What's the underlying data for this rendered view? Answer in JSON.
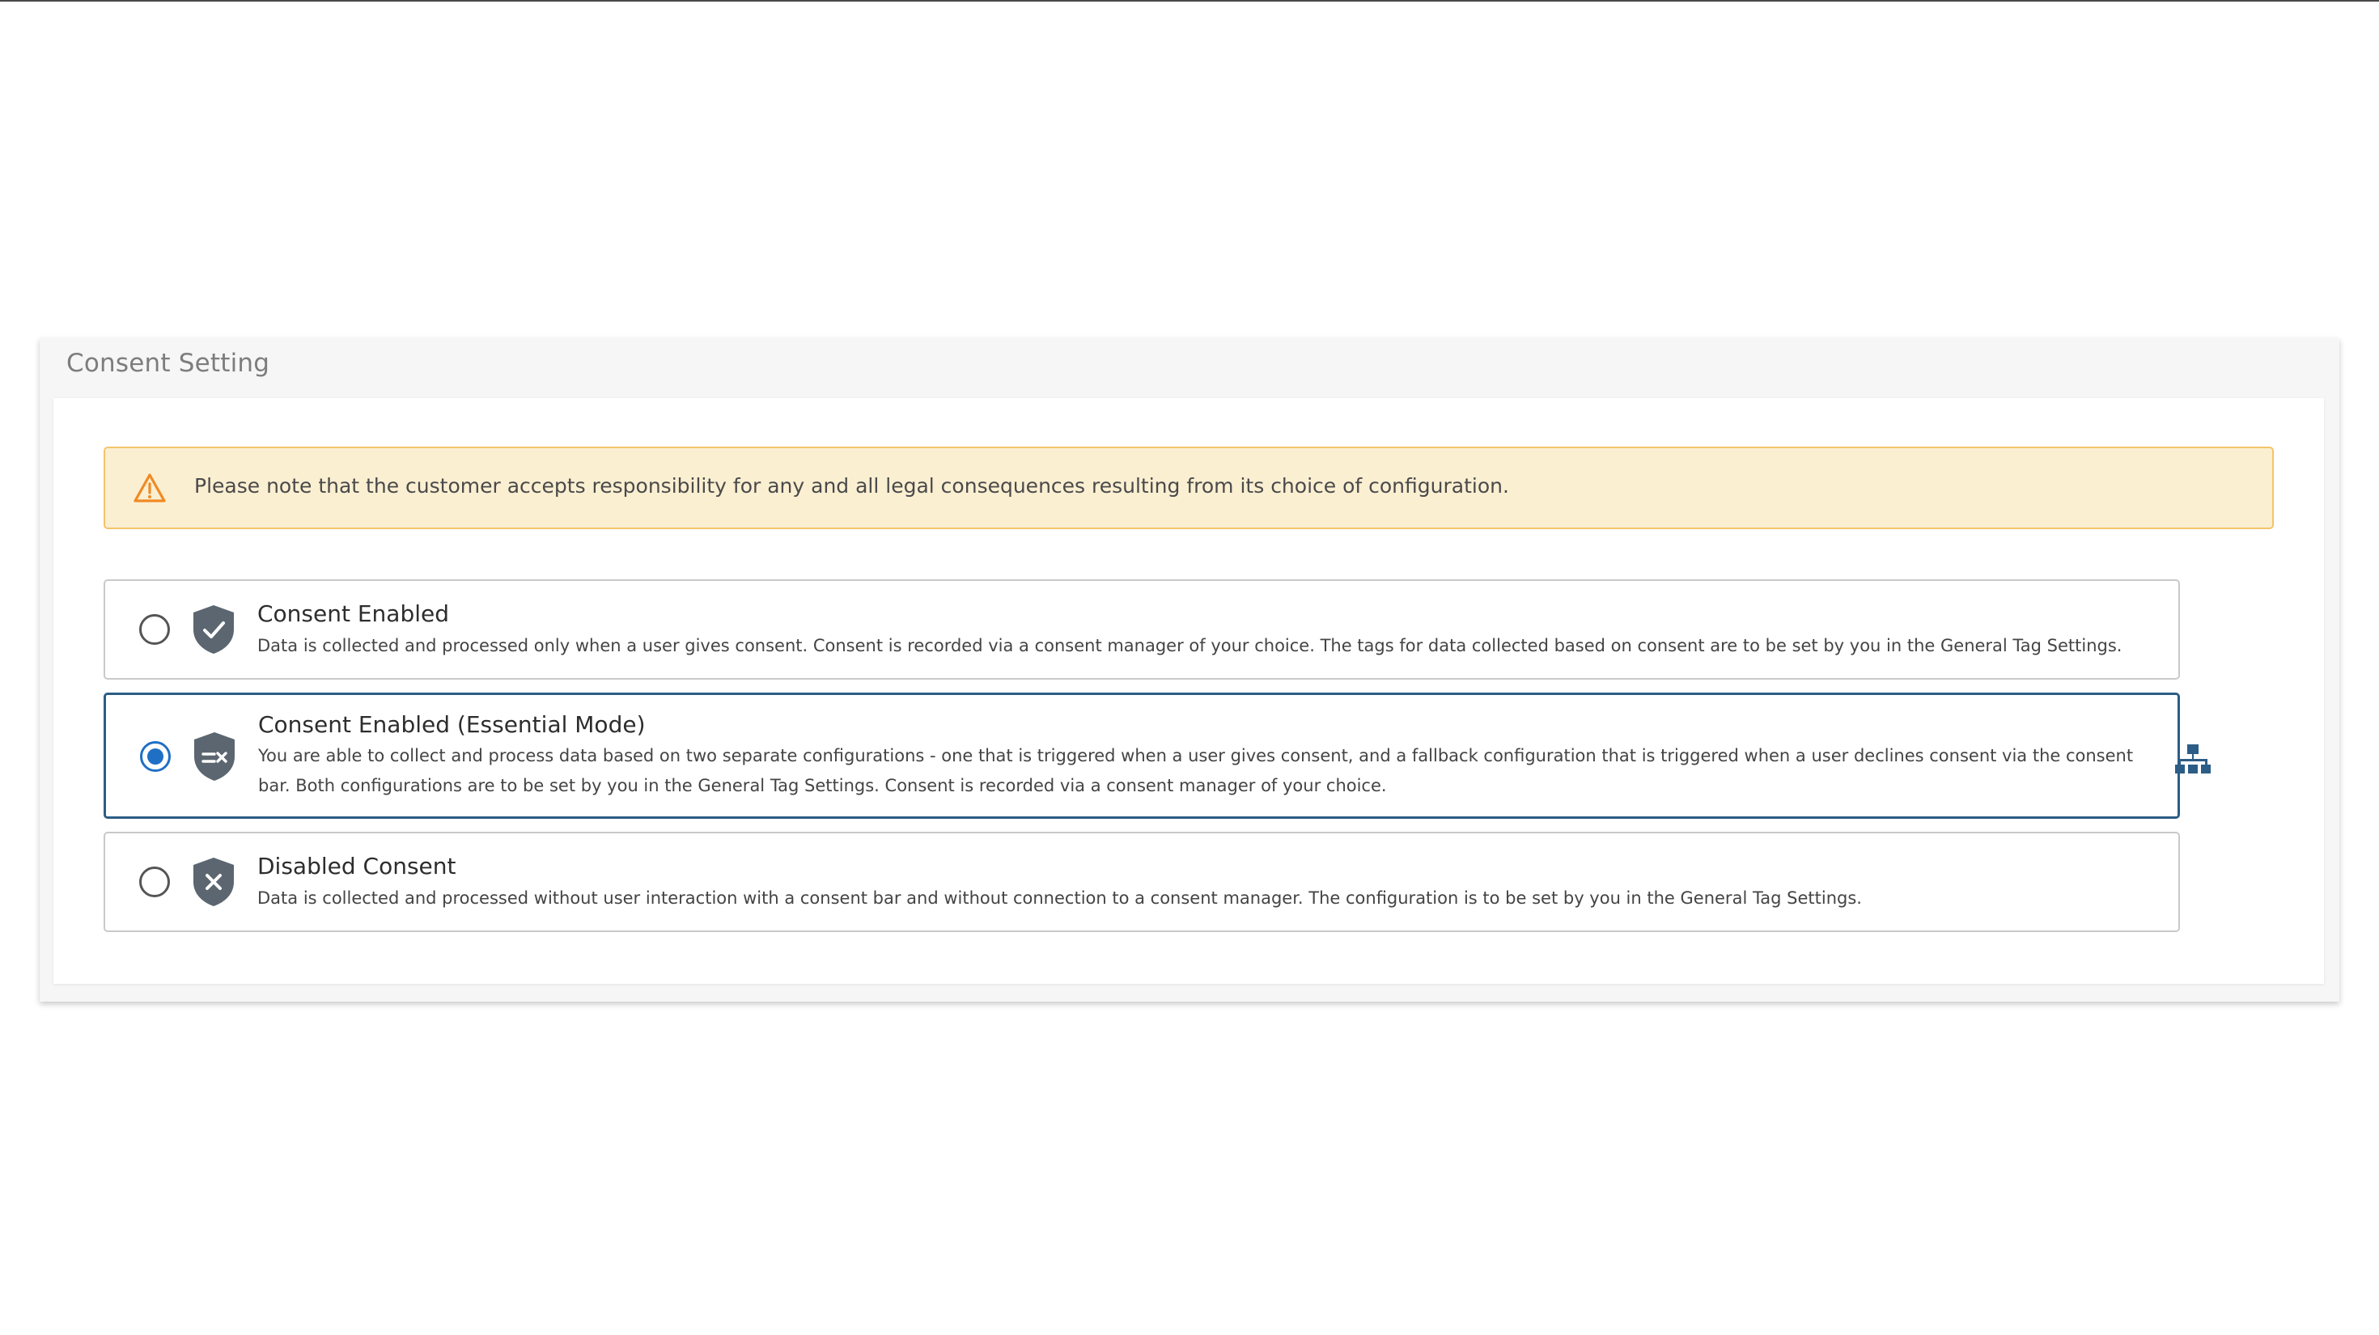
{
  "panel": {
    "title": "Consent Setting"
  },
  "warning": {
    "icon": "warning-triangle-icon",
    "text": "Please note that the customer accepts responsibility for any and all legal consequences resulting from its choice of configuration.",
    "accent": "#f08a24"
  },
  "options": [
    {
      "title": "Consent Enabled",
      "description": "Data is collected and processed only when a user gives consent. Consent is recorded via a consent manager of your choice. The tags for data collected based on consent are to be set by you in the General Tag Settings.",
      "icon": "shield-check-icon",
      "selected": false
    },
    {
      "title": "Consent Enabled (Essential Mode)",
      "description": "You are able to collect and process data based on two separate configurations - one that is triggered when a user gives consent, and a fallback configuration that is triggered when a user declines consent via the consent bar. Both configurations are to be set by you in the General Tag Settings. Consent is recorded via a consent manager of your choice.",
      "icon": "shield-essential-icon",
      "selected": true
    },
    {
      "title": "Disabled Consent",
      "description": "Data is collected and processed without user interaction with a consent bar and without connection to a consent manager. The configuration is to be set by you in the General Tag Settings.",
      "icon": "shield-x-icon",
      "selected": false
    }
  ],
  "side_icon": "hierarchy-icon",
  "colors": {
    "selected_border": "#2c5d86",
    "radio_selected": "#1f6fc5",
    "shield": "#5c6670",
    "warning_bg": "#fbefd2",
    "warning_border": "#f3c46a"
  }
}
